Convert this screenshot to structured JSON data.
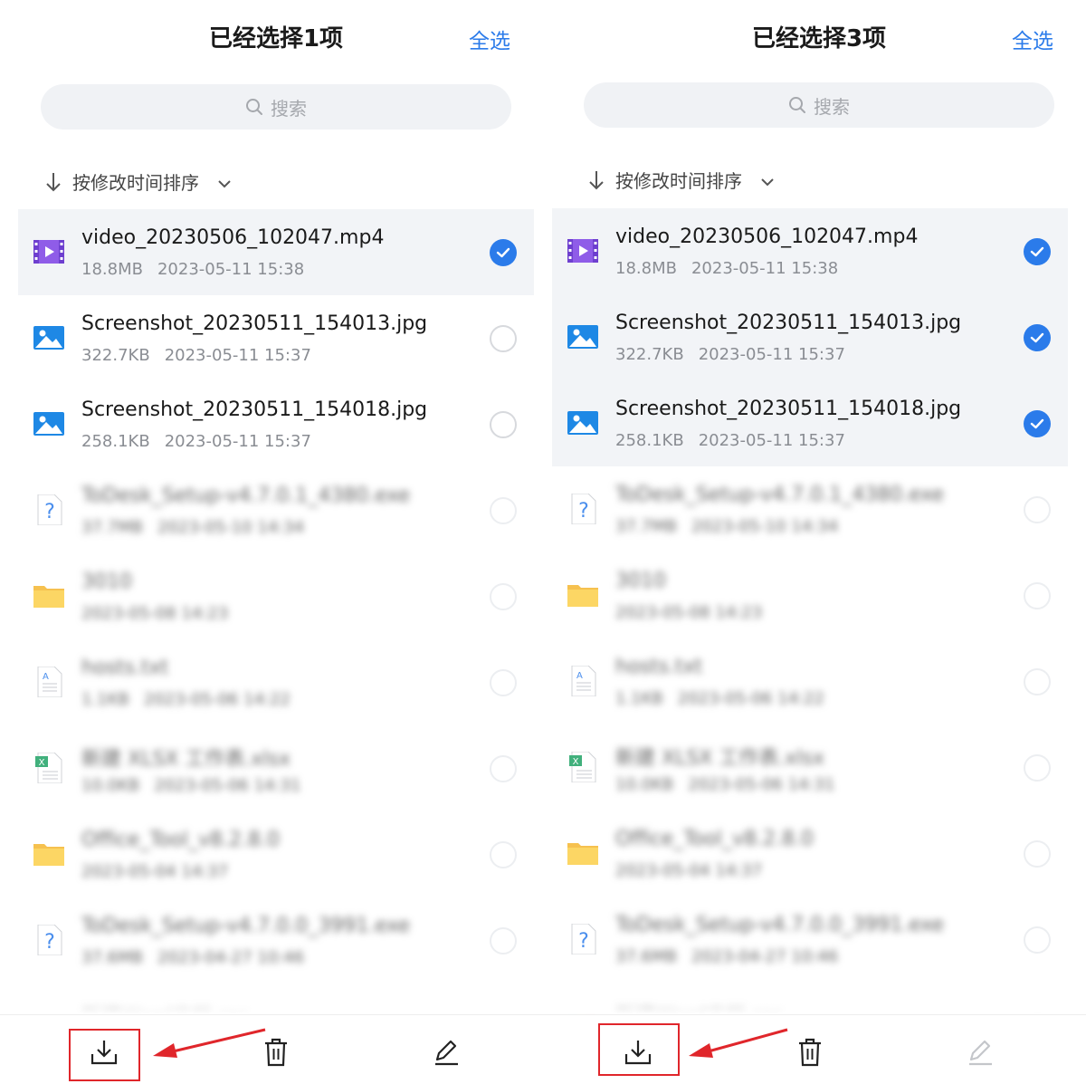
{
  "panels": [
    {
      "title": "已经选择1项",
      "select_all": "全选",
      "search_placeholder": "搜索",
      "sort_label": "按修改时间排序",
      "files": [
        {
          "name": "video_20230506_102047.mp4",
          "size": "18.8MB",
          "date": "2023-05-11 15:38",
          "icon": "video-file-icon",
          "selected": true
        },
        {
          "name": "Screenshot_20230511_154013.jpg",
          "size": "322.7KB",
          "date": "2023-05-11 15:37",
          "icon": "image-file-icon",
          "selected": false
        },
        {
          "name": "Screenshot_20230511_154018.jpg",
          "size": "258.1KB",
          "date": "2023-05-11 15:37",
          "icon": "image-file-icon",
          "selected": false
        },
        {
          "name": "ToDesk_Setup-v4.7.0.1_4380.exe",
          "size": "37.7MB",
          "date": "2023-05-10 14:34",
          "icon": "unknown-file-icon",
          "selected": false,
          "blurred": true
        },
        {
          "name": "3010",
          "size": "",
          "date": "2023-05-08 14:23",
          "icon": "folder-icon",
          "selected": false,
          "blurred": true
        },
        {
          "name": "hosts.txt",
          "size": "1.1KB",
          "date": "2023-05-06 14:22",
          "icon": "text-file-icon",
          "selected": false,
          "blurred": true
        },
        {
          "name": "新建 XLSX 工作表.xlsx",
          "size": "10.0KB",
          "date": "2023-05-06 14:31",
          "icon": "excel-file-icon",
          "selected": false,
          "blurred": true
        },
        {
          "name": "Office_Tool_v8.2.8.0",
          "size": "",
          "date": "2023-05-04 14:37",
          "icon": "folder-icon",
          "selected": false,
          "blurred": true
        },
        {
          "name": "ToDesk_Setup-v4.7.0.0_3991.exe",
          "size": "37.6MB",
          "date": "2023-04-27 10:46",
          "icon": "unknown-file-icon",
          "selected": false,
          "blurred": true
        },
        {
          "name": "新建Word文档.rar",
          "size": "",
          "date": "",
          "icon": "archive-file-icon",
          "selected": false,
          "blurred": true
        }
      ],
      "toolbar": {
        "download_icon": "download-icon",
        "delete_icon": "trash-icon",
        "rename_icon": "edit-icon",
        "rename_enabled": true
      }
    },
    {
      "title": "已经选择3项",
      "select_all": "全选",
      "search_placeholder": "搜索",
      "sort_label": "按修改时间排序",
      "files": [
        {
          "name": "video_20230506_102047.mp4",
          "size": "18.8MB",
          "date": "2023-05-11 15:38",
          "icon": "video-file-icon",
          "selected": true
        },
        {
          "name": "Screenshot_20230511_154013.jpg",
          "size": "322.7KB",
          "date": "2023-05-11 15:37",
          "icon": "image-file-icon",
          "selected": true
        },
        {
          "name": "Screenshot_20230511_154018.jpg",
          "size": "258.1KB",
          "date": "2023-05-11 15:37",
          "icon": "image-file-icon",
          "selected": true
        },
        {
          "name": "ToDesk_Setup-v4.7.0.1_4380.exe",
          "size": "37.7MB",
          "date": "2023-05-10 14:34",
          "icon": "unknown-file-icon",
          "selected": false,
          "blurred": true
        },
        {
          "name": "3010",
          "size": "",
          "date": "2023-05-08 14:23",
          "icon": "folder-icon",
          "selected": false,
          "blurred": true
        },
        {
          "name": "hosts.txt",
          "size": "1.1KB",
          "date": "2023-05-06 14:22",
          "icon": "text-file-icon",
          "selected": false,
          "blurred": true
        },
        {
          "name": "新建 XLSX 工作表.xlsx",
          "size": "10.0KB",
          "date": "2023-05-06 14:31",
          "icon": "excel-file-icon",
          "selected": false,
          "blurred": true
        },
        {
          "name": "Office_Tool_v8.2.8.0",
          "size": "",
          "date": "2023-05-04 14:37",
          "icon": "folder-icon",
          "selected": false,
          "blurred": true
        },
        {
          "name": "ToDesk_Setup-v4.7.0.0_3991.exe",
          "size": "37.6MB",
          "date": "2023-04-27 10:46",
          "icon": "unknown-file-icon",
          "selected": false,
          "blurred": true
        },
        {
          "name": "新建Word文档.rar",
          "size": "",
          "date": "",
          "icon": "archive-file-icon",
          "selected": false,
          "blurred": true
        }
      ],
      "toolbar": {
        "download_icon": "download-icon",
        "delete_icon": "trash-icon",
        "rename_icon": "edit-icon",
        "rename_enabled": false
      }
    }
  ],
  "colors": {
    "accent": "#2b7bea",
    "annotation_red": "#e0262b",
    "selected_row_bg": "#f2f4f7"
  }
}
